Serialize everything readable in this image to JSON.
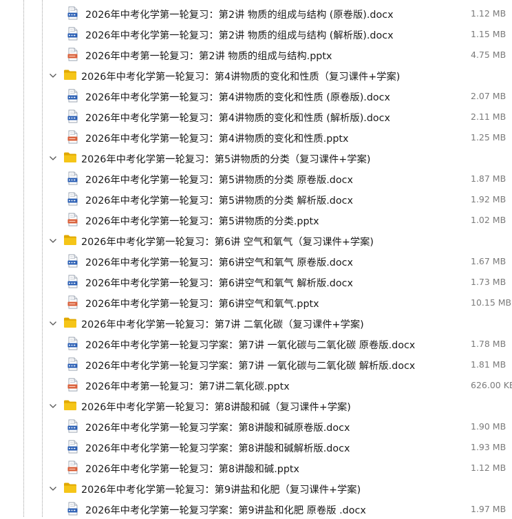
{
  "tree": [
    {
      "type": "file",
      "kind": "docx",
      "icon": "docx-file-icon",
      "name": "2026年中考化学第一轮复习：第2讲 物质的组成与结构 (原卷版).docx",
      "size": "1.12 MB"
    },
    {
      "type": "file",
      "kind": "docx",
      "icon": "docx-file-icon",
      "name": "2026年中考化学第一轮复习：第2讲 物质的组成与结构 (解析版).docx",
      "size": "1.15 MB"
    },
    {
      "type": "file",
      "kind": "pptx",
      "icon": "pptx-file-icon",
      "name": "2026年中考第一轮复习：第2讲 物质的组成与结构.pptx",
      "size": "4.75 MB"
    },
    {
      "type": "folder",
      "icon": "folder-icon",
      "name": "2026年中考化学第一轮复习：第4讲物质的变化和性质（复习课件+学案)"
    },
    {
      "type": "file",
      "kind": "docx",
      "icon": "docx-file-icon",
      "name": "2026年中考化学第一轮复习：第4讲物质的变化和性质 (原卷版).docx",
      "size": "2.07 MB"
    },
    {
      "type": "file",
      "kind": "docx",
      "icon": "docx-file-icon",
      "name": "2026年中考化学第一轮复习：第4讲物质的变化和性质 (解析版).docx",
      "size": "2.11 MB"
    },
    {
      "type": "file",
      "kind": "pptx",
      "icon": "pptx-file-icon",
      "name": "2026年中考化学第一轮复习：第4讲物质的变化和性质.pptx",
      "size": "1.25 MB"
    },
    {
      "type": "folder",
      "icon": "folder-icon",
      "name": "2026年中考化学第一轮复习：第5讲物质的分类（复习课件+学案)"
    },
    {
      "type": "file",
      "kind": "docx",
      "icon": "docx-file-icon",
      "name": "2026年中考化学第一轮复习：第5讲物质的分类 原卷版.docx",
      "size": "1.87 MB"
    },
    {
      "type": "file",
      "kind": "docx",
      "icon": "docx-file-icon",
      "name": "2026年中考化学第一轮复习：第5讲物质的分类 解析版.docx",
      "size": "1.92 MB"
    },
    {
      "type": "file",
      "kind": "pptx",
      "icon": "pptx-file-icon",
      "name": "2026年中考化学第一轮复习：第5讲物质的分类.pptx",
      "size": "1.02 MB"
    },
    {
      "type": "folder",
      "icon": "folder-icon",
      "name": "2026年中考化学第一轮复习：第6讲 空气和氧气（复习课件+学案)"
    },
    {
      "type": "file",
      "kind": "docx",
      "icon": "docx-file-icon",
      "name": "2026年中考化学第一轮复习：第6讲空气和氧气 原卷版.docx",
      "size": "1.67 MB"
    },
    {
      "type": "file",
      "kind": "docx",
      "icon": "docx-file-icon",
      "name": "2026年中考化学第一轮复习：第6讲空气和氧气 解析版.docx",
      "size": "1.73 MB"
    },
    {
      "type": "file",
      "kind": "pptx",
      "icon": "pptx-file-icon",
      "name": "2026年中考化学第一轮复习：第6讲空气和氧气.pptx",
      "size": "10.15 MB"
    },
    {
      "type": "folder",
      "icon": "folder-icon",
      "name": "2026年中考化学第一轮复习：第7讲 二氧化碳（复习课件+学案)"
    },
    {
      "type": "file",
      "kind": "docx",
      "icon": "docx-file-icon",
      "name": "2026年中考化学第一轮复习学案：第7讲 一氧化碳与二氧化碳 原卷版.docx",
      "size": "1.78 MB"
    },
    {
      "type": "file",
      "kind": "docx",
      "icon": "docx-file-icon",
      "name": "2026年中考化学第一轮复习学案：第7讲 一氧化碳与二氧化碳 解析版.docx",
      "size": "1.81 MB"
    },
    {
      "type": "file",
      "kind": "pptx",
      "icon": "pptx-file-icon",
      "name": "2026年中考第一轮复习：第7讲二氧化碳.pptx",
      "size": "626.00 KB"
    },
    {
      "type": "folder",
      "icon": "folder-icon",
      "name": "2026年中考化学第一轮复习：第8讲酸和碱（复习课件+学案)"
    },
    {
      "type": "file",
      "kind": "docx",
      "icon": "docx-file-icon",
      "name": "2026年中考化学第一轮复习学案：第8讲酸和碱原卷版.docx",
      "size": "1.90 MB"
    },
    {
      "type": "file",
      "kind": "docx",
      "icon": "docx-file-icon",
      "name": "2026年中考化学第一轮复习学案：第8讲酸和碱解析版.docx",
      "size": "1.93 MB"
    },
    {
      "type": "file",
      "kind": "pptx",
      "icon": "pptx-file-icon",
      "name": "2026年中考化学第一轮复习：第8讲酸和碱.pptx",
      "size": "1.12 MB"
    },
    {
      "type": "folder",
      "icon": "folder-icon",
      "name": "2026年中考化学第一轮复习：第9讲盐和化肥（复习课件+学案)"
    },
    {
      "type": "file",
      "kind": "docx",
      "icon": "docx-file-icon",
      "name": "2026年中考化学第一轮复习学案：第9讲盐和化肥 原卷版 .docx",
      "size": "1.97 MB"
    }
  ],
  "colors": {
    "folder": "#f5c518",
    "folder_dark": "#e0a800",
    "docx": "#2b5fb4",
    "pptx": "#d9603b",
    "size_text": "#7a7a7a"
  }
}
